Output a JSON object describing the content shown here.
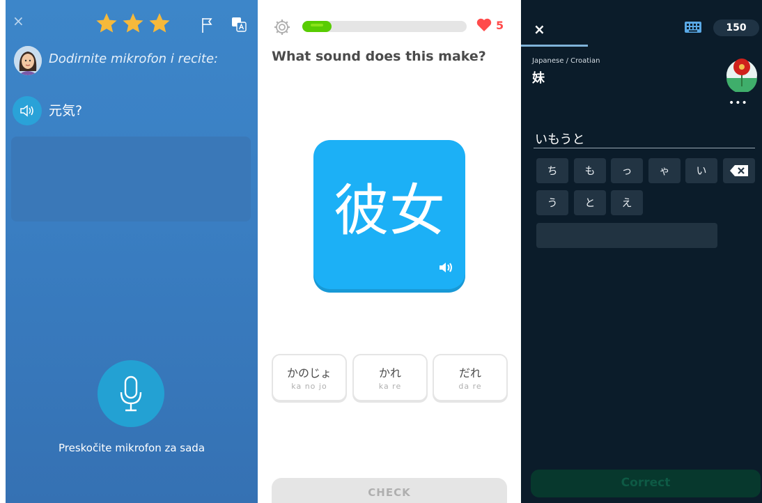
{
  "panel1": {
    "close_glyph": "×",
    "stars_icon": "star-icon",
    "prompt": "Dodirnite mikrofon i recite:",
    "phrase": "元気?",
    "skip_label": "Preskočite mikrofon za sada",
    "colors": {
      "star": "#f6b93b",
      "mic": "#23a1d3"
    }
  },
  "panel2": {
    "hearts": "5",
    "progress_fraction": 0.18,
    "question": "What sound does this make?",
    "card_text": "彼女",
    "choices": [
      {
        "kana": "かのじょ",
        "romaji": "ka no  jo"
      },
      {
        "kana": "かれ",
        "romaji": "ka re"
      },
      {
        "kana": "だれ",
        "romaji": "da re"
      }
    ],
    "check_label": "CHECK",
    "colors": {
      "card": "#1cb0f6",
      "progress": "#58cc02",
      "heart": "#ff4b4b"
    }
  },
  "panel3": {
    "close_glyph": "×",
    "score": "150",
    "lang": "Japanese / Croatian",
    "word": "妹",
    "more": "•••",
    "answer": "いもうと",
    "keys_row1": [
      "ち",
      "も",
      "っ",
      "ゃ",
      "い"
    ],
    "keys_row2": [
      "う",
      "と",
      "え"
    ],
    "correct_label": "Correct"
  }
}
